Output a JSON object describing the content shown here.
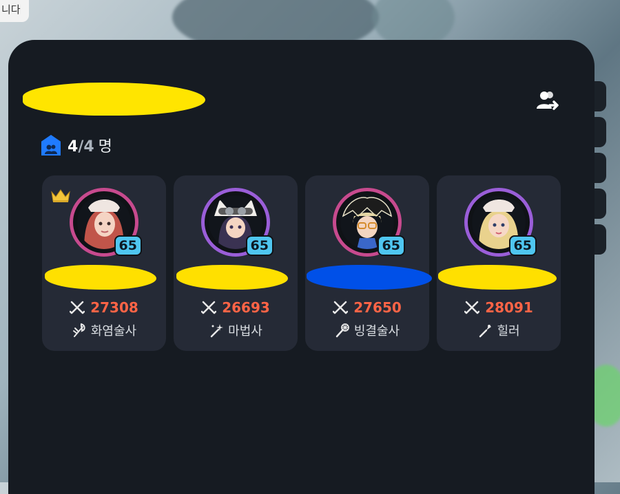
{
  "top_notice": "니다",
  "party": {
    "current_members": "4",
    "separator": "/",
    "max_members": "4",
    "unit": "명"
  },
  "colors": {
    "panel_bg": "#161b22",
    "card_bg": "#252a36",
    "power_red": "#ff6446",
    "level_badge": "#4fc6f0",
    "ring_pink": "#c74a8e",
    "ring_purple": "#9a5ed8",
    "party_icon_blue": "#1f7bff"
  },
  "members": [
    {
      "level": "65",
      "power": "27308",
      "class_name": "화염술사",
      "class_icon": "flame-staff-icon",
      "leader": true,
      "ring": "pink",
      "name_mark": "yellow"
    },
    {
      "level": "65",
      "power": "26693",
      "class_name": "마법사",
      "class_icon": "magic-wand-icon",
      "leader": false,
      "ring": "purple",
      "name_mark": "yellow"
    },
    {
      "level": "65",
      "power": "27650",
      "class_name": "빙결술사",
      "class_icon": "frost-staff-icon",
      "leader": false,
      "ring": "pink",
      "name_mark": "blue"
    },
    {
      "level": "65",
      "power": "28091",
      "class_name": "힐러",
      "class_icon": "healing-staff-icon",
      "leader": false,
      "ring": "purple",
      "name_mark": "yellow"
    }
  ]
}
